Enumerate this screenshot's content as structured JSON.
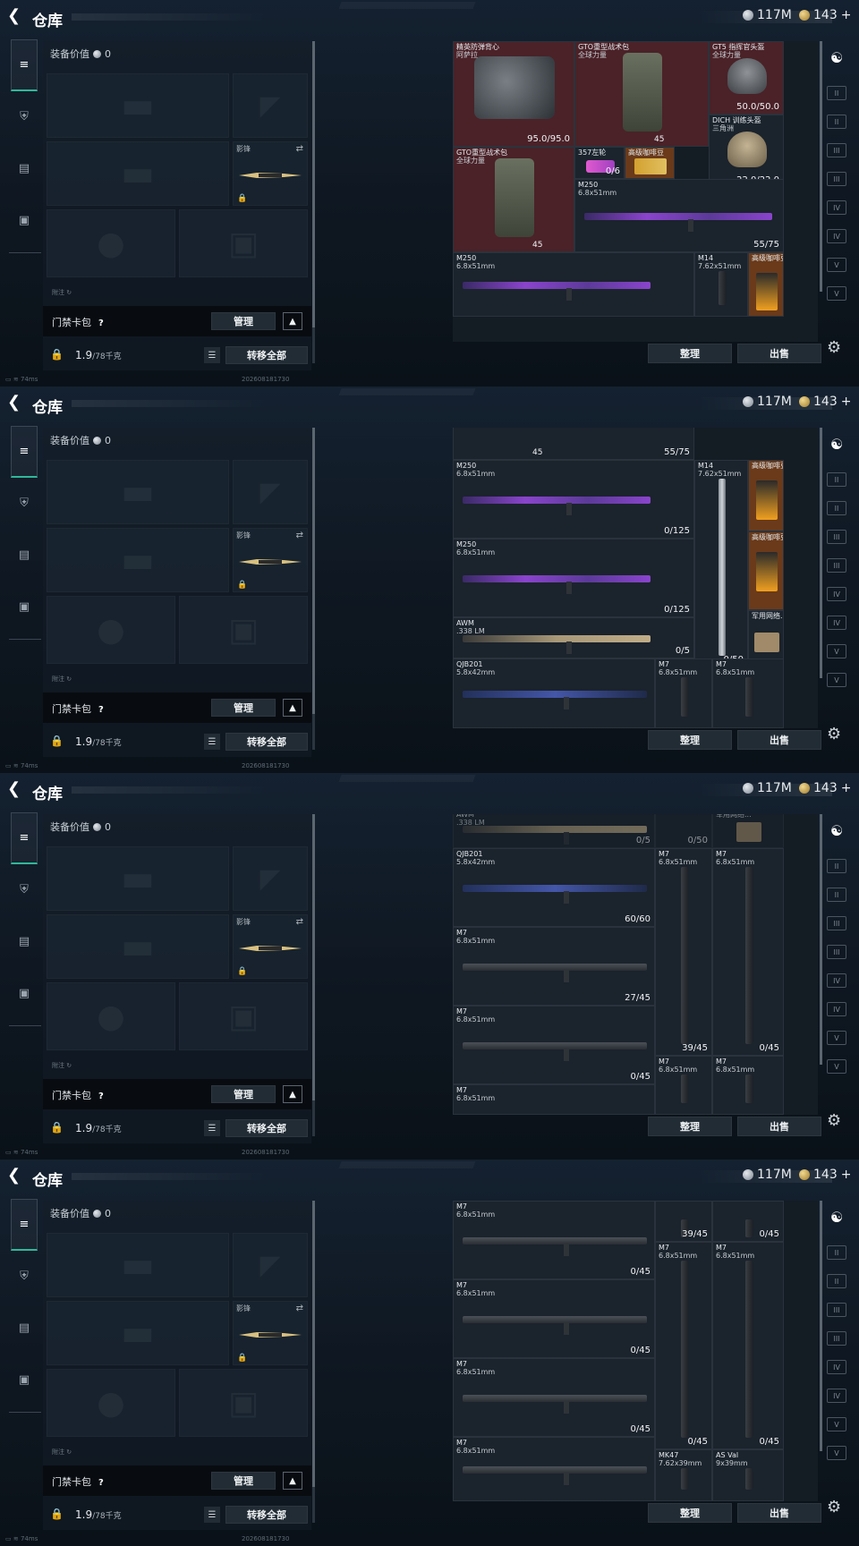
{
  "header": {
    "title": "仓库",
    "silver_amount": "117M",
    "gold_amount": "143",
    "gold_plus": "+"
  },
  "equipment": {
    "value_label": "装备价值",
    "value": "0",
    "melee_label": "影锋",
    "hint": "附注 ↻",
    "card_label": "门禁卡包",
    "card_help": "?",
    "manage_label": "管理",
    "weight_current": "1.9",
    "weight_max": "/78千克",
    "transfer_all_label": "转移全部"
  },
  "status": {
    "latency": "74ms",
    "timestamp": "202608181730"
  },
  "actions": {
    "sort_label": "整理",
    "sell_label": "出售"
  },
  "icons": {
    "back": "back-arrow-icon",
    "settings": "gear-icon",
    "lock": "lock-icon",
    "swap": "swap-icon",
    "list": "list-icon",
    "vault": "vault-icon"
  },
  "colors": {
    "accent_teal": "#2fb89a",
    "rare_red": "#4a2228",
    "legendary_gold": "#6a3a1a"
  },
  "screens": [
    {
      "items": [
        {
          "name": "精英防弹背心",
          "sub": "阿萨拉",
          "value": "95.0/95.0"
        },
        {
          "name": "GTO重型战术包",
          "sub": "全球力量",
          "count": "45"
        },
        {
          "name": "GT5 指挥官头盔",
          "sub": "全球力量",
          "value": "50.0/50.0"
        },
        {
          "name": "DICH 训练头盔",
          "sub": "三角洲",
          "value": "22.0/22.0"
        },
        {
          "name": "GTO重型战术包",
          "sub": "全球力量",
          "count": "45"
        },
        {
          "name": "357左轮",
          "sub": "",
          "value": "0/6"
        },
        {
          "name": "高级咖啡豆",
          "sub": ""
        },
        {
          "name": "M250",
          "sub": "6.8x51mm",
          "value": "55/75"
        },
        {
          "name": "M250",
          "sub": "6.8x51mm",
          "value": ""
        },
        {
          "name": "M14",
          "sub": "7.62x51mm",
          "value": ""
        },
        {
          "name": "高级咖啡豆",
          "sub": ""
        }
      ]
    },
    {
      "items": [
        {
          "count": "45",
          "value": "55/75"
        },
        {
          "name": "M250",
          "sub": "6.8x51mm",
          "value": "0/125"
        },
        {
          "name": "M14",
          "sub": "7.62x51mm",
          "value": "0/50"
        },
        {
          "name": "高级咖啡豆",
          "sub": ""
        },
        {
          "name": "M250",
          "sub": "6.8x51mm",
          "value": "0/125"
        },
        {
          "name": "高级咖啡豆",
          "sub": ""
        },
        {
          "name": "AWM",
          "sub": ".338 LM",
          "value": "0/5"
        },
        {
          "name": "军用网络...",
          "sub": ""
        },
        {
          "name": "QJB201",
          "sub": "5.8x42mm",
          "value": ""
        },
        {
          "name": "M7",
          "sub": "6.8x51mm",
          "value": ""
        },
        {
          "name": "M7",
          "sub": "6.8x51mm",
          "value": ""
        }
      ]
    },
    {
      "items": [
        {
          "name": "AWM",
          "sub": ".338 LM",
          "value": "0/5"
        },
        {
          "value": "0/50"
        },
        {
          "name": "军用网络...",
          "sub": ""
        },
        {
          "name": "QJB201",
          "sub": "5.8x42mm",
          "value": "60/60"
        },
        {
          "name": "M7",
          "sub": "6.8x51mm",
          "value": "39/45"
        },
        {
          "name": "M7",
          "sub": "6.8x51mm",
          "value": "0/45"
        },
        {
          "name": "M7",
          "sub": "6.8x51mm",
          "value": "27/45"
        },
        {
          "name": "M7",
          "sub": "6.8x51mm",
          "value": "0/45"
        },
        {
          "name": "M7",
          "sub": "6.8x51mm",
          "value": ""
        },
        {
          "name": "M7",
          "sub": "6.8x51mm",
          "value": ""
        },
        {
          "name": "M7",
          "sub": "6.8x51mm",
          "value": ""
        }
      ]
    },
    {
      "items": [
        {
          "name": "M7",
          "sub": "6.8x51mm",
          "value": "0/45"
        },
        {
          "value": "39/45"
        },
        {
          "value": "0/45"
        },
        {
          "name": "M7",
          "sub": "6.8x51mm",
          "value": "0/45"
        },
        {
          "name": "M7",
          "sub": "6.8x51mm",
          "value": "0/45"
        },
        {
          "name": "M7",
          "sub": "6.8x51mm",
          "value": "0/45"
        },
        {
          "name": "M7",
          "sub": "6.8x51mm",
          "value": "0/45"
        },
        {
          "name": "M7",
          "sub": "6.8x51mm",
          "value": "0/45"
        },
        {
          "name": "M7",
          "sub": "6.8x51mm",
          "value": ""
        },
        {
          "name": "MK47",
          "sub": "7.62x39mm",
          "value": ""
        },
        {
          "name": "AS Val",
          "sub": "9x39mm",
          "value": ""
        }
      ]
    }
  ]
}
